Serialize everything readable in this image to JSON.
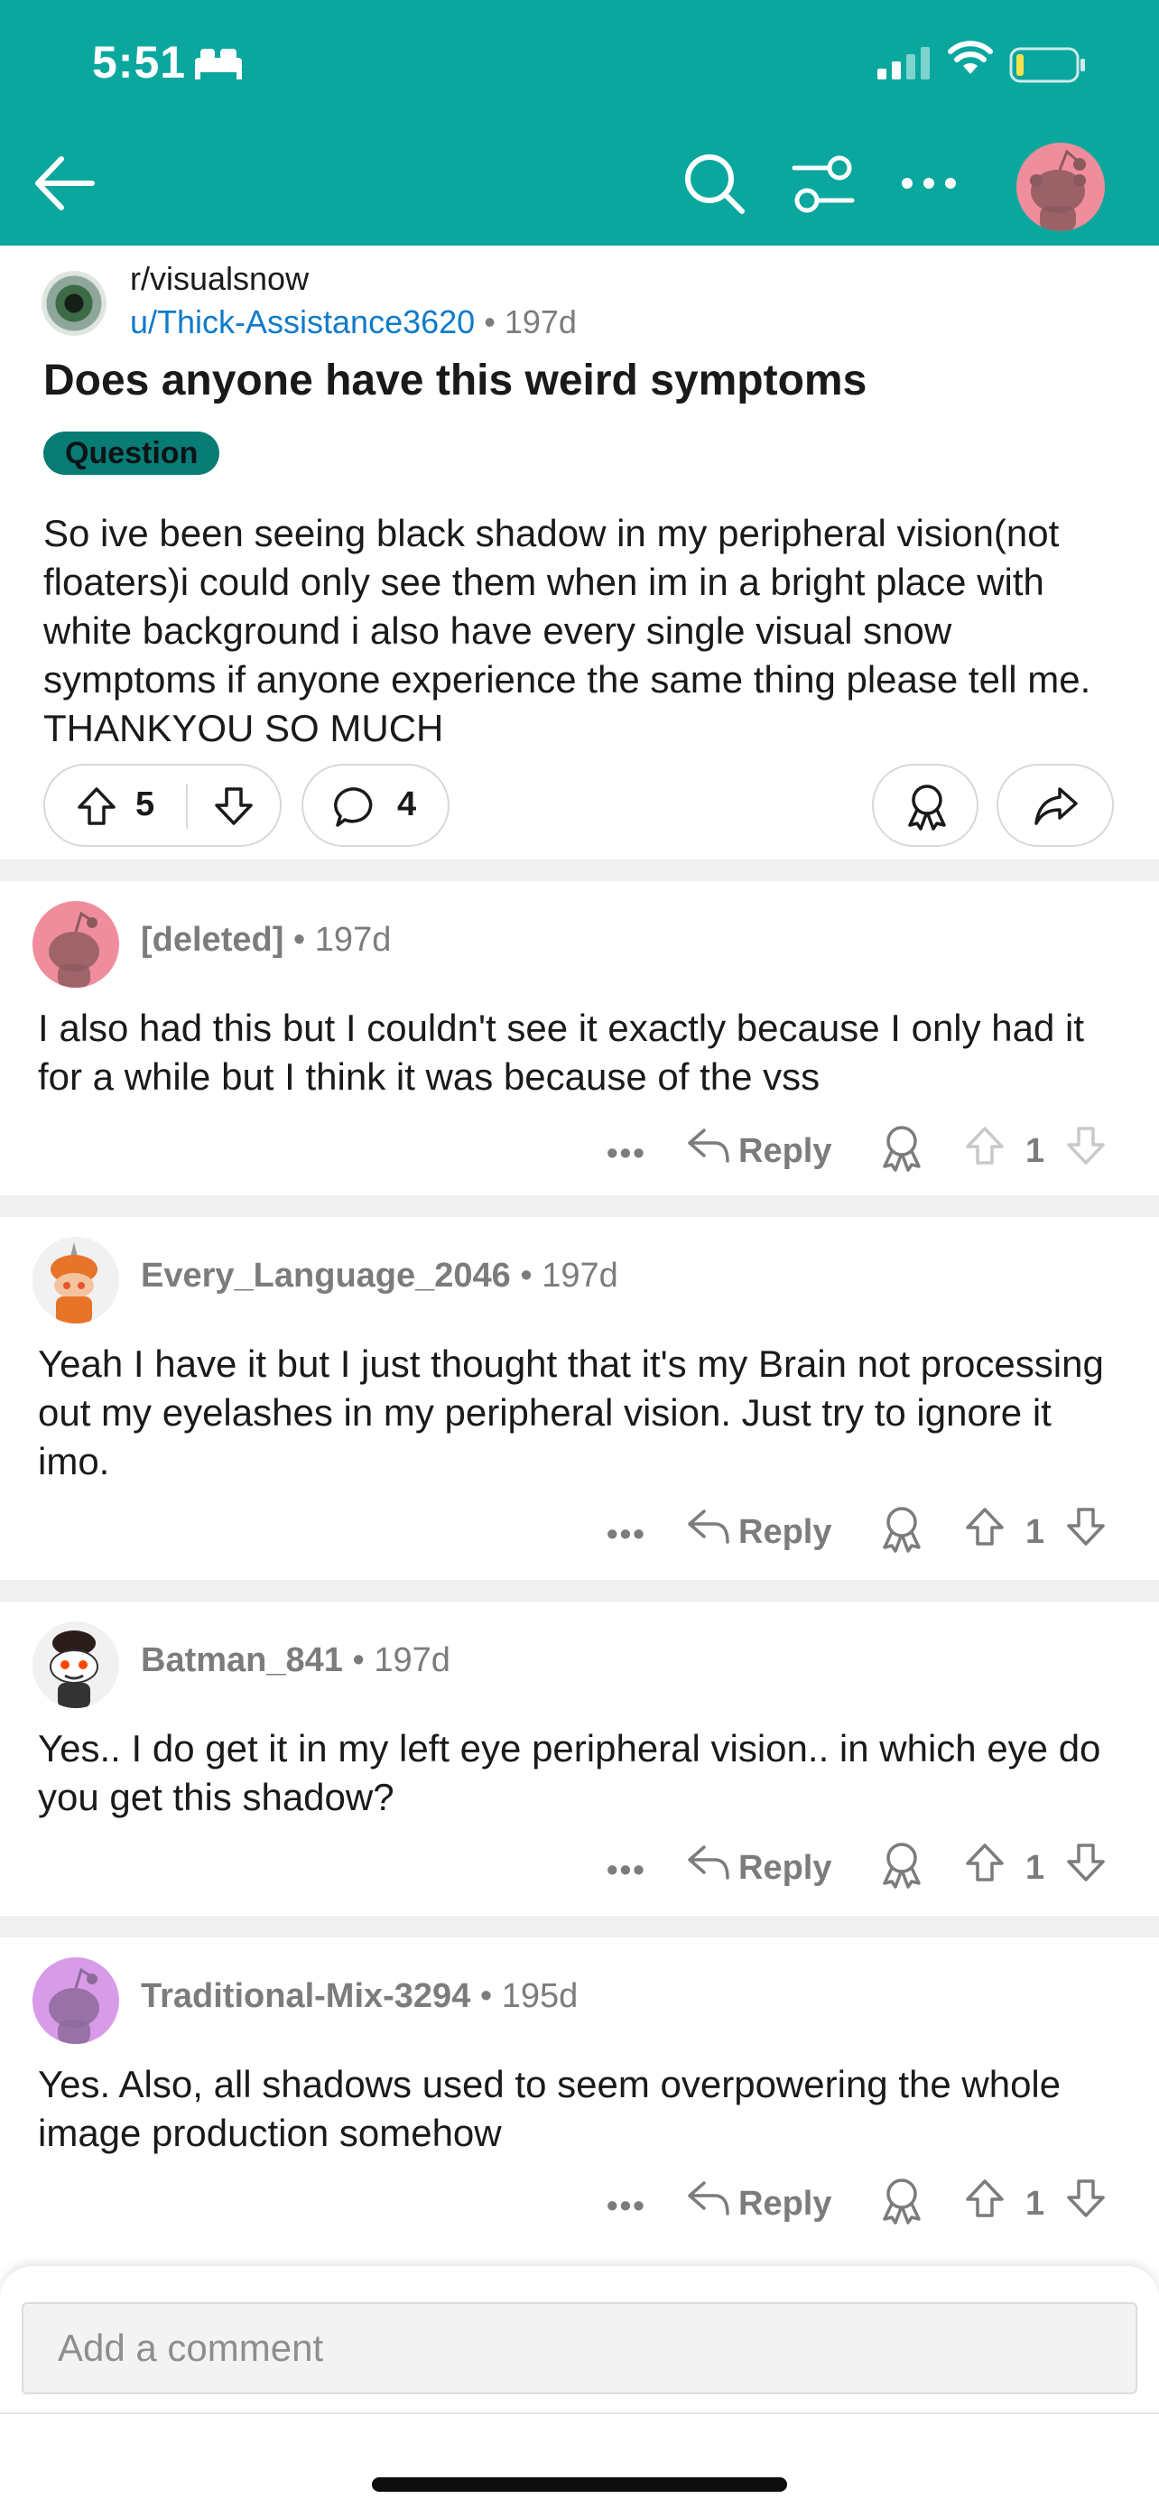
{
  "status_bar": {
    "time": "5:51"
  },
  "post": {
    "subreddit": "r/visualsnow",
    "author": "u/Thick-Assistance3620",
    "age": "197d",
    "title": "Does anyone have this weird symptoms",
    "flair": "Question",
    "body": "So ive been seeing black shadow in my peripheral vision(not floaters)i could only see them when im in a bright place with white background i also have every single visual snow symptoms if anyone experience the same thing please tell me. THANKYOU SO MUCH",
    "score": "5",
    "comment_count": "4"
  },
  "comments": [
    {
      "author": "[deleted]",
      "age": "197d",
      "body": "I also had this but I couldn't see it exactly because I only had it for a while but I think it was because of the vss",
      "reply_label": "Reply",
      "score": "1"
    },
    {
      "author": "Every_Language_2046",
      "age": "197d",
      "body": "Yeah I have it but I just thought that it's my Brain not processing out my eyelashes in my peripheral vision. Just try to ignore it imo.",
      "reply_label": "Reply",
      "score": "1"
    },
    {
      "author": "Batman_841",
      "age": "197d",
      "body": "Yes.. I do get it in my left eye peripheral vision.. in which eye do you get this shadow?",
      "reply_label": "Reply",
      "score": "1"
    },
    {
      "author": "Traditional-Mix-3294",
      "age": "195d",
      "body": "Yes. Also, all shadows used to seem overpowering the whole image production somehow",
      "reply_label": "Reply",
      "score": "1"
    }
  ],
  "composer": {
    "placeholder": "Add a comment"
  },
  "separators": {
    "dot": "•",
    "more": "•••"
  },
  "colors": {
    "header": "#0aa79e",
    "flair": "#087c74",
    "link": "#0f7bc9",
    "avatar_pink": "#f08d9c",
    "avatar_purple": "#d79be8"
  },
  "icons": [
    "back-arrow-icon",
    "search-icon",
    "filter-icon",
    "more-icon",
    "upvote-icon",
    "downvote-icon",
    "comment-bubble-icon",
    "award-icon",
    "share-icon",
    "reply-icon"
  ]
}
